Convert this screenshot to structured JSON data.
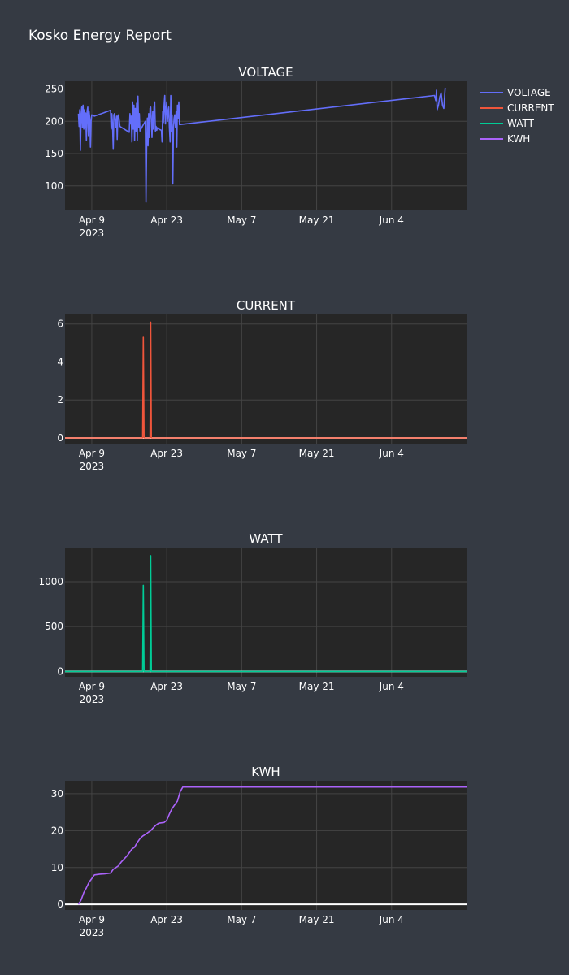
{
  "report": {
    "title": "Kosko Energy Report"
  },
  "legend": {
    "placement": "top-right",
    "entries": [
      {
        "name": "VOLTAGE",
        "color": "#636efa"
      },
      {
        "name": "CURRENT",
        "color": "#ef553b"
      },
      {
        "name": "WATT",
        "color": "#00cc96"
      },
      {
        "name": "KWH",
        "color": "#ab63fa"
      }
    ]
  },
  "theme": {
    "page_bg": "#353a43",
    "plot_bg": "#262626",
    "grid": "#444444",
    "zero_line": "#ffffff",
    "text": "#ffffff"
  },
  "chart_data": [
    {
      "type": "line",
      "title": "VOLTAGE",
      "xlabel": "",
      "ylabel": "",
      "xlim": [
        "2023-04-04",
        "2023-06-18"
      ],
      "ylim": [
        62,
        262
      ],
      "grid": true,
      "x_ticks": [
        {
          "x": "2023-04-09",
          "label": "Apr 9",
          "sub": "2023"
        },
        {
          "x": "2023-04-23",
          "label": "Apr 23",
          "sub": ""
        },
        {
          "x": "2023-05-07",
          "label": "May 7",
          "sub": ""
        },
        {
          "x": "2023-05-21",
          "label": "May 21",
          "sub": ""
        },
        {
          "x": "2023-06-04",
          "label": "Jun 4",
          "sub": ""
        }
      ],
      "y_ticks": [
        100,
        150,
        200,
        250
      ],
      "series": [
        {
          "name": "VOLTAGE",
          "color": "#636efa",
          "points": [
            [
              "2023-04-06 12:00",
              212
            ],
            [
              "2023-04-06 15:00",
              192
            ],
            [
              "2023-04-06 18:00",
              218
            ],
            [
              "2023-04-06 21:00",
              155
            ],
            [
              "2023-04-07 00:00",
              212
            ],
            [
              "2023-04-07 03:00",
              222
            ],
            [
              "2023-04-07 06:00",
              190
            ],
            [
              "2023-04-07 09:00",
              225
            ],
            [
              "2023-04-07 12:00",
              188
            ],
            [
              "2023-04-07 15:00",
              218
            ],
            [
              "2023-04-07 18:00",
              190
            ],
            [
              "2023-04-07 21:00",
              213
            ],
            [
              "2023-04-08 00:00",
              170
            ],
            [
              "2023-04-08 03:00",
              216
            ],
            [
              "2023-04-08 06:00",
              222
            ],
            [
              "2023-04-08 09:00",
              178
            ],
            [
              "2023-04-08 12:00",
              215
            ],
            [
              "2023-04-08 15:00",
              205
            ],
            [
              "2023-04-08 18:00",
              160
            ],
            [
              "2023-04-08 21:00",
              200
            ],
            [
              "2023-04-09 00:00",
              210
            ],
            [
              "2023-04-09 12:00",
              208
            ],
            [
              "2023-04-12 12:00",
              217
            ],
            [
              "2023-04-12 15:00",
              188
            ],
            [
              "2023-04-12 18:00",
              212
            ],
            [
              "2023-04-12 21:00",
              193
            ],
            [
              "2023-04-13 00:00",
              158
            ],
            [
              "2023-04-13 03:00",
              210
            ],
            [
              "2023-04-13 06:00",
              212
            ],
            [
              "2023-04-13 09:00",
              200
            ],
            [
              "2023-04-13 12:00",
              190
            ],
            [
              "2023-04-13 15:00",
              208
            ],
            [
              "2023-04-13 18:00",
              172
            ],
            [
              "2023-04-13 21:00",
              208
            ],
            [
              "2023-04-14 00:00",
              210
            ],
            [
              "2023-04-14 06:00",
              192
            ],
            [
              "2023-04-16 00:00",
              183
            ],
            [
              "2023-04-16 03:00",
              212
            ],
            [
              "2023-04-16 06:00",
              196
            ],
            [
              "2023-04-16 09:00",
              208
            ],
            [
              "2023-04-16 12:00",
              168
            ],
            [
              "2023-04-16 15:00",
              230
            ],
            [
              "2023-04-16 18:00",
              188
            ],
            [
              "2023-04-16 21:00",
              225
            ],
            [
              "2023-04-17 00:00",
              170
            ],
            [
              "2023-04-17 03:00",
              220
            ],
            [
              "2023-04-17 06:00",
              185
            ],
            [
              "2023-04-17 09:00",
              228
            ],
            [
              "2023-04-17 12:00",
              170
            ],
            [
              "2023-04-17 15:00",
              239
            ],
            [
              "2023-04-17 18:00",
              190
            ],
            [
              "2023-04-17 21:00",
              212
            ],
            [
              "2023-04-18 00:00",
              185
            ],
            [
              "2023-04-18 12:00",
              193
            ],
            [
              "2023-04-19 00:00",
              200
            ],
            [
              "2023-04-19 03:00",
              75
            ],
            [
              "2023-04-19 06:00",
              160
            ],
            [
              "2023-04-19 09:00",
              205
            ],
            [
              "2023-04-19 12:00",
              162
            ],
            [
              "2023-04-19 15:00",
              212
            ],
            [
              "2023-04-19 18:00",
              175
            ],
            [
              "2023-04-19 21:00",
              220
            ],
            [
              "2023-04-20 00:00",
              222
            ],
            [
              "2023-04-20 03:00",
              200
            ],
            [
              "2023-04-20 06:00",
              175
            ],
            [
              "2023-04-20 09:00",
              215
            ],
            [
              "2023-04-20 12:00",
              188
            ],
            [
              "2023-04-20 15:00",
              222
            ],
            [
              "2023-04-20 18:00",
              230
            ],
            [
              "2023-04-20 21:00",
              185
            ],
            [
              "2023-04-21 00:00",
              192
            ],
            [
              "2023-04-21 03:00",
              186
            ],
            [
              "2023-04-21 06:00",
              190
            ],
            [
              "2023-04-21 12:00",
              188
            ],
            [
              "2023-04-22 00:00",
              186
            ],
            [
              "2023-04-22 03:00",
              168
            ],
            [
              "2023-04-22 06:00",
              215
            ],
            [
              "2023-04-22 09:00",
              198
            ],
            [
              "2023-04-22 12:00",
              225
            ],
            [
              "2023-04-22 15:00",
              240
            ],
            [
              "2023-04-22 18:00",
              196
            ],
            [
              "2023-04-22 21:00",
              218
            ],
            [
              "2023-04-23 00:00",
              230
            ],
            [
              "2023-04-23 03:00",
              200
            ],
            [
              "2023-04-23 06:00",
              215
            ],
            [
              "2023-04-23 09:00",
              222
            ],
            [
              "2023-04-23 12:00",
              190
            ],
            [
              "2023-04-23 15:00",
              168
            ],
            [
              "2023-04-23 18:00",
              240
            ],
            [
              "2023-04-23 21:00",
              185
            ],
            [
              "2023-04-24 00:00",
              210
            ],
            [
              "2023-04-24 03:00",
              103
            ],
            [
              "2023-04-24 06:00",
              190
            ],
            [
              "2023-04-24 09:00",
              205
            ],
            [
              "2023-04-24 12:00",
              210
            ],
            [
              "2023-04-24 15:00",
              190
            ],
            [
              "2023-04-24 18:00",
              215
            ],
            [
              "2023-04-24 21:00",
              160
            ],
            [
              "2023-04-25 00:00",
              225
            ],
            [
              "2023-04-25 03:00",
              205
            ],
            [
              "2023-04-25 06:00",
              230
            ],
            [
              "2023-04-25 09:00",
              195
            ],
            [
              "2023-06-12 00:00",
              240
            ],
            [
              "2023-06-12 06:00",
              232
            ],
            [
              "2023-06-12 09:00",
              248
            ],
            [
              "2023-06-12 12:00",
              218
            ],
            [
              "2023-06-12 18:00",
              225
            ],
            [
              "2023-06-13 00:00",
              238
            ],
            [
              "2023-06-13 06:00",
              244
            ],
            [
              "2023-06-13 12:00",
              225
            ],
            [
              "2023-06-13 18:00",
              220
            ],
            [
              "2023-06-14 00:00",
              252
            ]
          ]
        }
      ]
    },
    {
      "type": "line",
      "title": "CURRENT",
      "xlabel": "",
      "ylabel": "",
      "xlim": [
        "2023-04-04",
        "2023-06-18"
      ],
      "ylim": [
        -0.3,
        6.5
      ],
      "grid": true,
      "x_ticks": [
        {
          "x": "2023-04-09",
          "label": "Apr 9",
          "sub": "2023"
        },
        {
          "x": "2023-04-23",
          "label": "Apr 23",
          "sub": ""
        },
        {
          "x": "2023-05-07",
          "label": "May 7",
          "sub": ""
        },
        {
          "x": "2023-05-21",
          "label": "May 21",
          "sub": ""
        },
        {
          "x": "2023-06-04",
          "label": "Jun 4",
          "sub": ""
        }
      ],
      "y_ticks": [
        0,
        2,
        4,
        6
      ],
      "series": [
        {
          "name": "CURRENT",
          "color": "#ef553b",
          "points": [
            [
              "2023-04-04 00:00",
              0
            ],
            [
              "2023-04-18 12:00",
              0
            ],
            [
              "2023-04-18 15:00",
              5.3
            ],
            [
              "2023-04-18 18:00",
              0
            ],
            [
              "2023-04-19 21:00",
              0
            ],
            [
              "2023-04-20 00:00",
              6.1
            ],
            [
              "2023-04-20 03:00",
              0
            ],
            [
              "2023-06-18 00:00",
              0
            ]
          ]
        }
      ]
    },
    {
      "type": "line",
      "title": "WATT",
      "xlabel": "",
      "ylabel": "",
      "xlim": [
        "2023-04-04",
        "2023-06-18"
      ],
      "ylim": [
        -60,
        1380
      ],
      "grid": true,
      "x_ticks": [
        {
          "x": "2023-04-09",
          "label": "Apr 9",
          "sub": "2023"
        },
        {
          "x": "2023-04-23",
          "label": "Apr 23",
          "sub": ""
        },
        {
          "x": "2023-05-07",
          "label": "May 7",
          "sub": ""
        },
        {
          "x": "2023-05-21",
          "label": "May 21",
          "sub": ""
        },
        {
          "x": "2023-06-04",
          "label": "Jun 4",
          "sub": ""
        }
      ],
      "y_ticks": [
        0,
        500,
        1000
      ],
      "series": [
        {
          "name": "WATT",
          "color": "#00cc96",
          "points": [
            [
              "2023-04-04 00:00",
              0
            ],
            [
              "2023-04-18 12:00",
              0
            ],
            [
              "2023-04-18 15:00",
              960
            ],
            [
              "2023-04-18 18:00",
              0
            ],
            [
              "2023-04-19 21:00",
              0
            ],
            [
              "2023-04-20 00:00",
              1290
            ],
            [
              "2023-04-20 03:00",
              0
            ],
            [
              "2023-06-18 00:00",
              0
            ]
          ]
        }
      ]
    },
    {
      "type": "line",
      "title": "KWH",
      "xlabel": "",
      "ylabel": "",
      "xlim": [
        "2023-04-04",
        "2023-06-18"
      ],
      "ylim": [
        -1.5,
        33.5
      ],
      "grid": true,
      "x_ticks": [
        {
          "x": "2023-04-09",
          "label": "Apr 9",
          "sub": "2023"
        },
        {
          "x": "2023-04-23",
          "label": "Apr 23",
          "sub": ""
        },
        {
          "x": "2023-05-07",
          "label": "May 7",
          "sub": ""
        },
        {
          "x": "2023-05-21",
          "label": "May 21",
          "sub": ""
        },
        {
          "x": "2023-06-04",
          "label": "Jun 4",
          "sub": ""
        }
      ],
      "y_ticks": [
        0,
        10,
        20,
        30
      ],
      "series": [
        {
          "name": "KWH",
          "color": "#ab63fa",
          "points": [
            [
              "2023-04-06 12:00",
              0
            ],
            [
              "2023-04-07 00:00",
              1.2
            ],
            [
              "2023-04-07 12:00",
              3.2
            ],
            [
              "2023-04-08 00:00",
              4.5
            ],
            [
              "2023-04-08 12:00",
              6
            ],
            [
              "2023-04-09 00:00",
              7
            ],
            [
              "2023-04-09 12:00",
              8
            ],
            [
              "2023-04-10 12:00",
              8.2
            ],
            [
              "2023-04-11 12:00",
              8.3
            ],
            [
              "2023-04-12 12:00",
              8.5
            ],
            [
              "2023-04-13 00:00",
              9.5
            ],
            [
              "2023-04-13 12:00",
              10
            ],
            [
              "2023-04-14 00:00",
              10.5
            ],
            [
              "2023-04-14 12:00",
              11.5
            ],
            [
              "2023-04-15 12:00",
              13
            ],
            [
              "2023-04-16 00:00",
              14
            ],
            [
              "2023-04-16 12:00",
              15
            ],
            [
              "2023-04-17 00:00",
              15.5
            ],
            [
              "2023-04-17 12:00",
              16.8
            ],
            [
              "2023-04-18 00:00",
              17.8
            ],
            [
              "2023-04-18 12:00",
              18.5
            ],
            [
              "2023-04-19 00:00",
              19
            ],
            [
              "2023-04-19 12:00",
              19.5
            ],
            [
              "2023-04-20 00:00",
              20
            ],
            [
              "2023-04-20 12:00",
              20.8
            ],
            [
              "2023-04-21 00:00",
              21.5
            ],
            [
              "2023-04-21 12:00",
              22
            ],
            [
              "2023-04-22 12:00",
              22.2
            ],
            [
              "2023-04-23 00:00",
              22.8
            ],
            [
              "2023-04-23 12:00",
              24.5
            ],
            [
              "2023-04-24 00:00",
              26
            ],
            [
              "2023-04-24 12:00",
              27
            ],
            [
              "2023-04-25 00:00",
              28
            ],
            [
              "2023-04-25 12:00",
              30.5
            ],
            [
              "2023-04-26 00:00",
              31.8
            ],
            [
              "2023-06-18 00:00",
              31.8
            ]
          ]
        }
      ]
    }
  ]
}
